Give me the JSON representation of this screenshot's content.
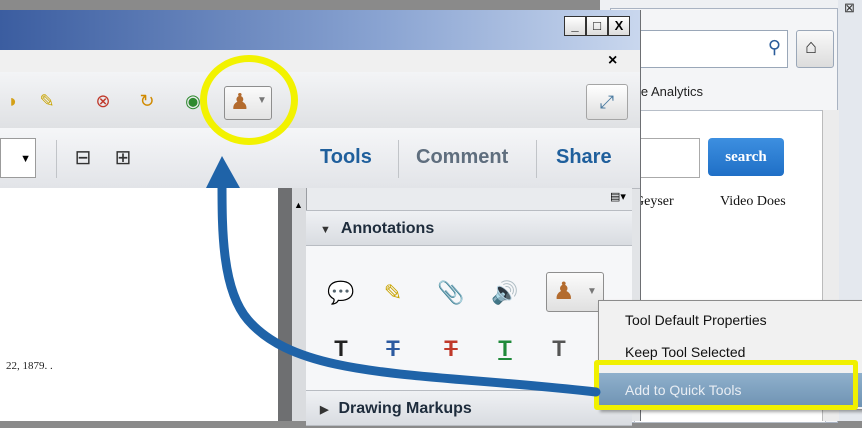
{
  "browser": {
    "tab_label": "le Analytics",
    "search_button_label": "search",
    "links": [
      "Geyser",
      "Video Does"
    ]
  },
  "window": {
    "min_label": "_",
    "max_label": "□",
    "close_label": "X",
    "doc_close_label": "×"
  },
  "panel_tabs": {
    "tools": "Tools",
    "comment": "Comment",
    "share": "Share"
  },
  "document": {
    "date_text": "22, 1879. ."
  },
  "sections": {
    "annotations": "Annotations",
    "drawing_markups": "Drawing Markups"
  },
  "context_menu": {
    "items": [
      "Tool Default Properties",
      "Keep Tool Selected",
      "Add to Quick Tools"
    ]
  },
  "colors": {
    "highlight": "#f2f200",
    "arrow": "#1f63a8",
    "panel_tab": "#1f5f9c"
  }
}
